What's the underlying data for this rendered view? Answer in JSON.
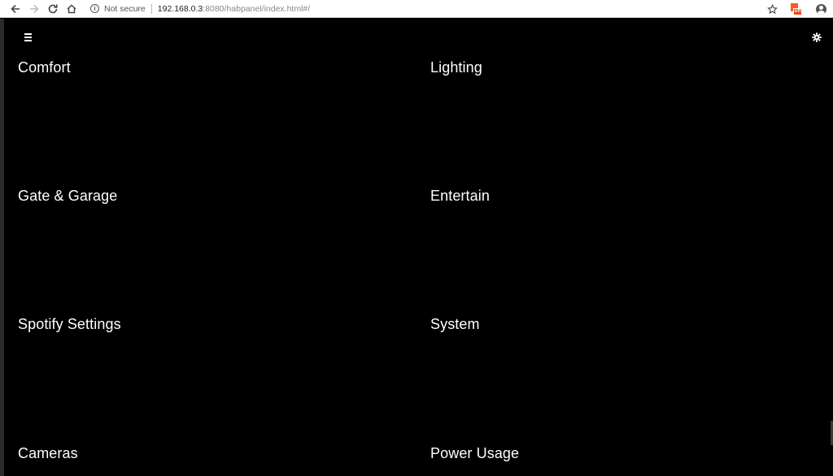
{
  "browser": {
    "security_label": "Not secure",
    "url_host": "192.168.0.3",
    "url_rest": ":8080/habpanel/index.html#/",
    "ext_badge": "off"
  },
  "icons": {
    "back": "arrow-left-icon",
    "forward": "arrow-right-icon",
    "reload": "reload-icon",
    "home": "home-icon",
    "info": "info-icon",
    "star": "star-icon",
    "extension": "extension-icon",
    "account": "account-icon",
    "menu": "hamburger-menu-icon",
    "settings": "gear-icon"
  },
  "colors": {
    "background": "#000000",
    "text": "#ffffff",
    "extension_accent": "#ff5a1f"
  },
  "dashboards": [
    {
      "label": "Comfort"
    },
    {
      "label": "Lighting"
    },
    {
      "label": "Gate & Garage"
    },
    {
      "label": "Entertain"
    },
    {
      "label": "Spotify Settings"
    },
    {
      "label": "System"
    },
    {
      "label": "Cameras"
    },
    {
      "label": "Power Usage"
    }
  ]
}
